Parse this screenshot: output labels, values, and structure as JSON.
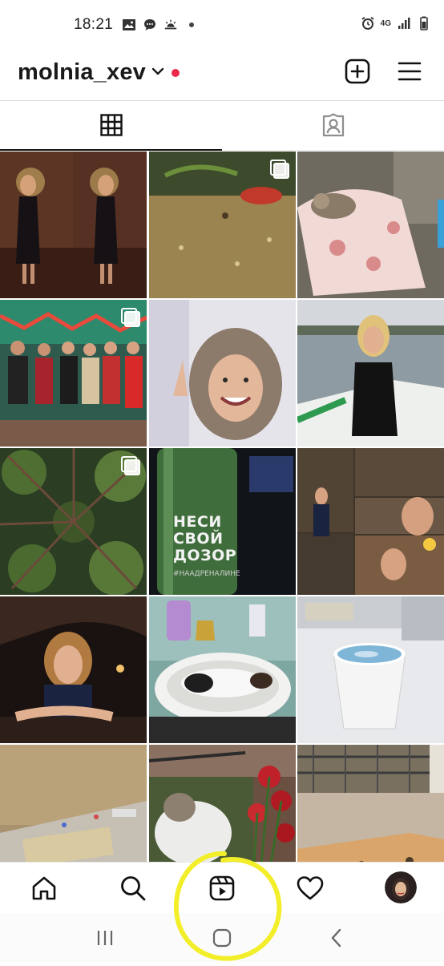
{
  "status_bar": {
    "time": "18:21",
    "left_icons": [
      "gallery-icon",
      "chat-icon",
      "weather-icon",
      "dot-icon"
    ],
    "right_icons": [
      "alarm-icon",
      "network-4g-icon",
      "signal-icon",
      "battery-icon"
    ],
    "network_label": "4G"
  },
  "header": {
    "username": "molnia_xev",
    "notification_dot_color": "#ed2a4b",
    "actions": [
      "new-post-icon",
      "menu-icon"
    ]
  },
  "tabs": [
    {
      "name": "grid",
      "icon": "grid-icon",
      "selected": true
    },
    {
      "name": "tagged",
      "icon": "tagged-person-icon",
      "selected": false
    }
  ],
  "grid": {
    "columns": 3,
    "posts": [
      {
        "row": 1,
        "col": 1,
        "subject": "two women in black dresses mirror selfie",
        "multi": false
      },
      {
        "row": 1,
        "col": 2,
        "subject": "terrarium with sand",
        "multi": true
      },
      {
        "row": 1,
        "col": 3,
        "subject": "cat sleeping on floral blanket",
        "multi": false
      },
      {
        "row": 2,
        "col": 1,
        "subject": "group photo at party",
        "multi": true
      },
      {
        "row": 2,
        "col": 2,
        "subject": "smiling woman selfie",
        "multi": false
      },
      {
        "row": 2,
        "col": 3,
        "subject": "woman in boat on lake",
        "multi": false
      },
      {
        "row": 3,
        "col": 1,
        "subject": "tree canopy from below",
        "multi": true
      },
      {
        "row": 3,
        "col": 2,
        "subject": "green bottle",
        "multi": false,
        "overlay_text": "НЕСИ СВОЙ ДОЗОР",
        "overlay_hashtag": "#НААДРЕНАЛИНЕ"
      },
      {
        "row": 3,
        "col": 3,
        "subject": "photo collage of woman",
        "multi": false
      },
      {
        "row": 4,
        "col": 1,
        "subject": "woman leaning on railing at night",
        "multi": false
      },
      {
        "row": 4,
        "col": 2,
        "subject": "cat lying in sink",
        "multi": false
      },
      {
        "row": 4,
        "col": 3,
        "subject": "blue latte in paper cup",
        "multi": false
      },
      {
        "row": 5,
        "col": 1,
        "subject": "room floor with items",
        "multi": false
      },
      {
        "row": 5,
        "col": 2,
        "subject": "cat with red roses",
        "multi": false
      },
      {
        "row": 5,
        "col": 3,
        "subject": "patio floor with rug",
        "multi": false
      }
    ]
  },
  "bottom_nav": {
    "items": [
      {
        "name": "home",
        "icon": "home-icon"
      },
      {
        "name": "search",
        "icon": "search-icon"
      },
      {
        "name": "reels",
        "icon": "reels-icon"
      },
      {
        "name": "activity",
        "icon": "heart-icon"
      },
      {
        "name": "profile",
        "icon": "avatar"
      }
    ]
  },
  "android_nav": {
    "items": [
      "recent-apps-icon",
      "home-button-icon",
      "back-icon"
    ]
  },
  "annotation": {
    "type": "hand-drawn circle",
    "color": "#f2ee2a",
    "target": "reels"
  }
}
